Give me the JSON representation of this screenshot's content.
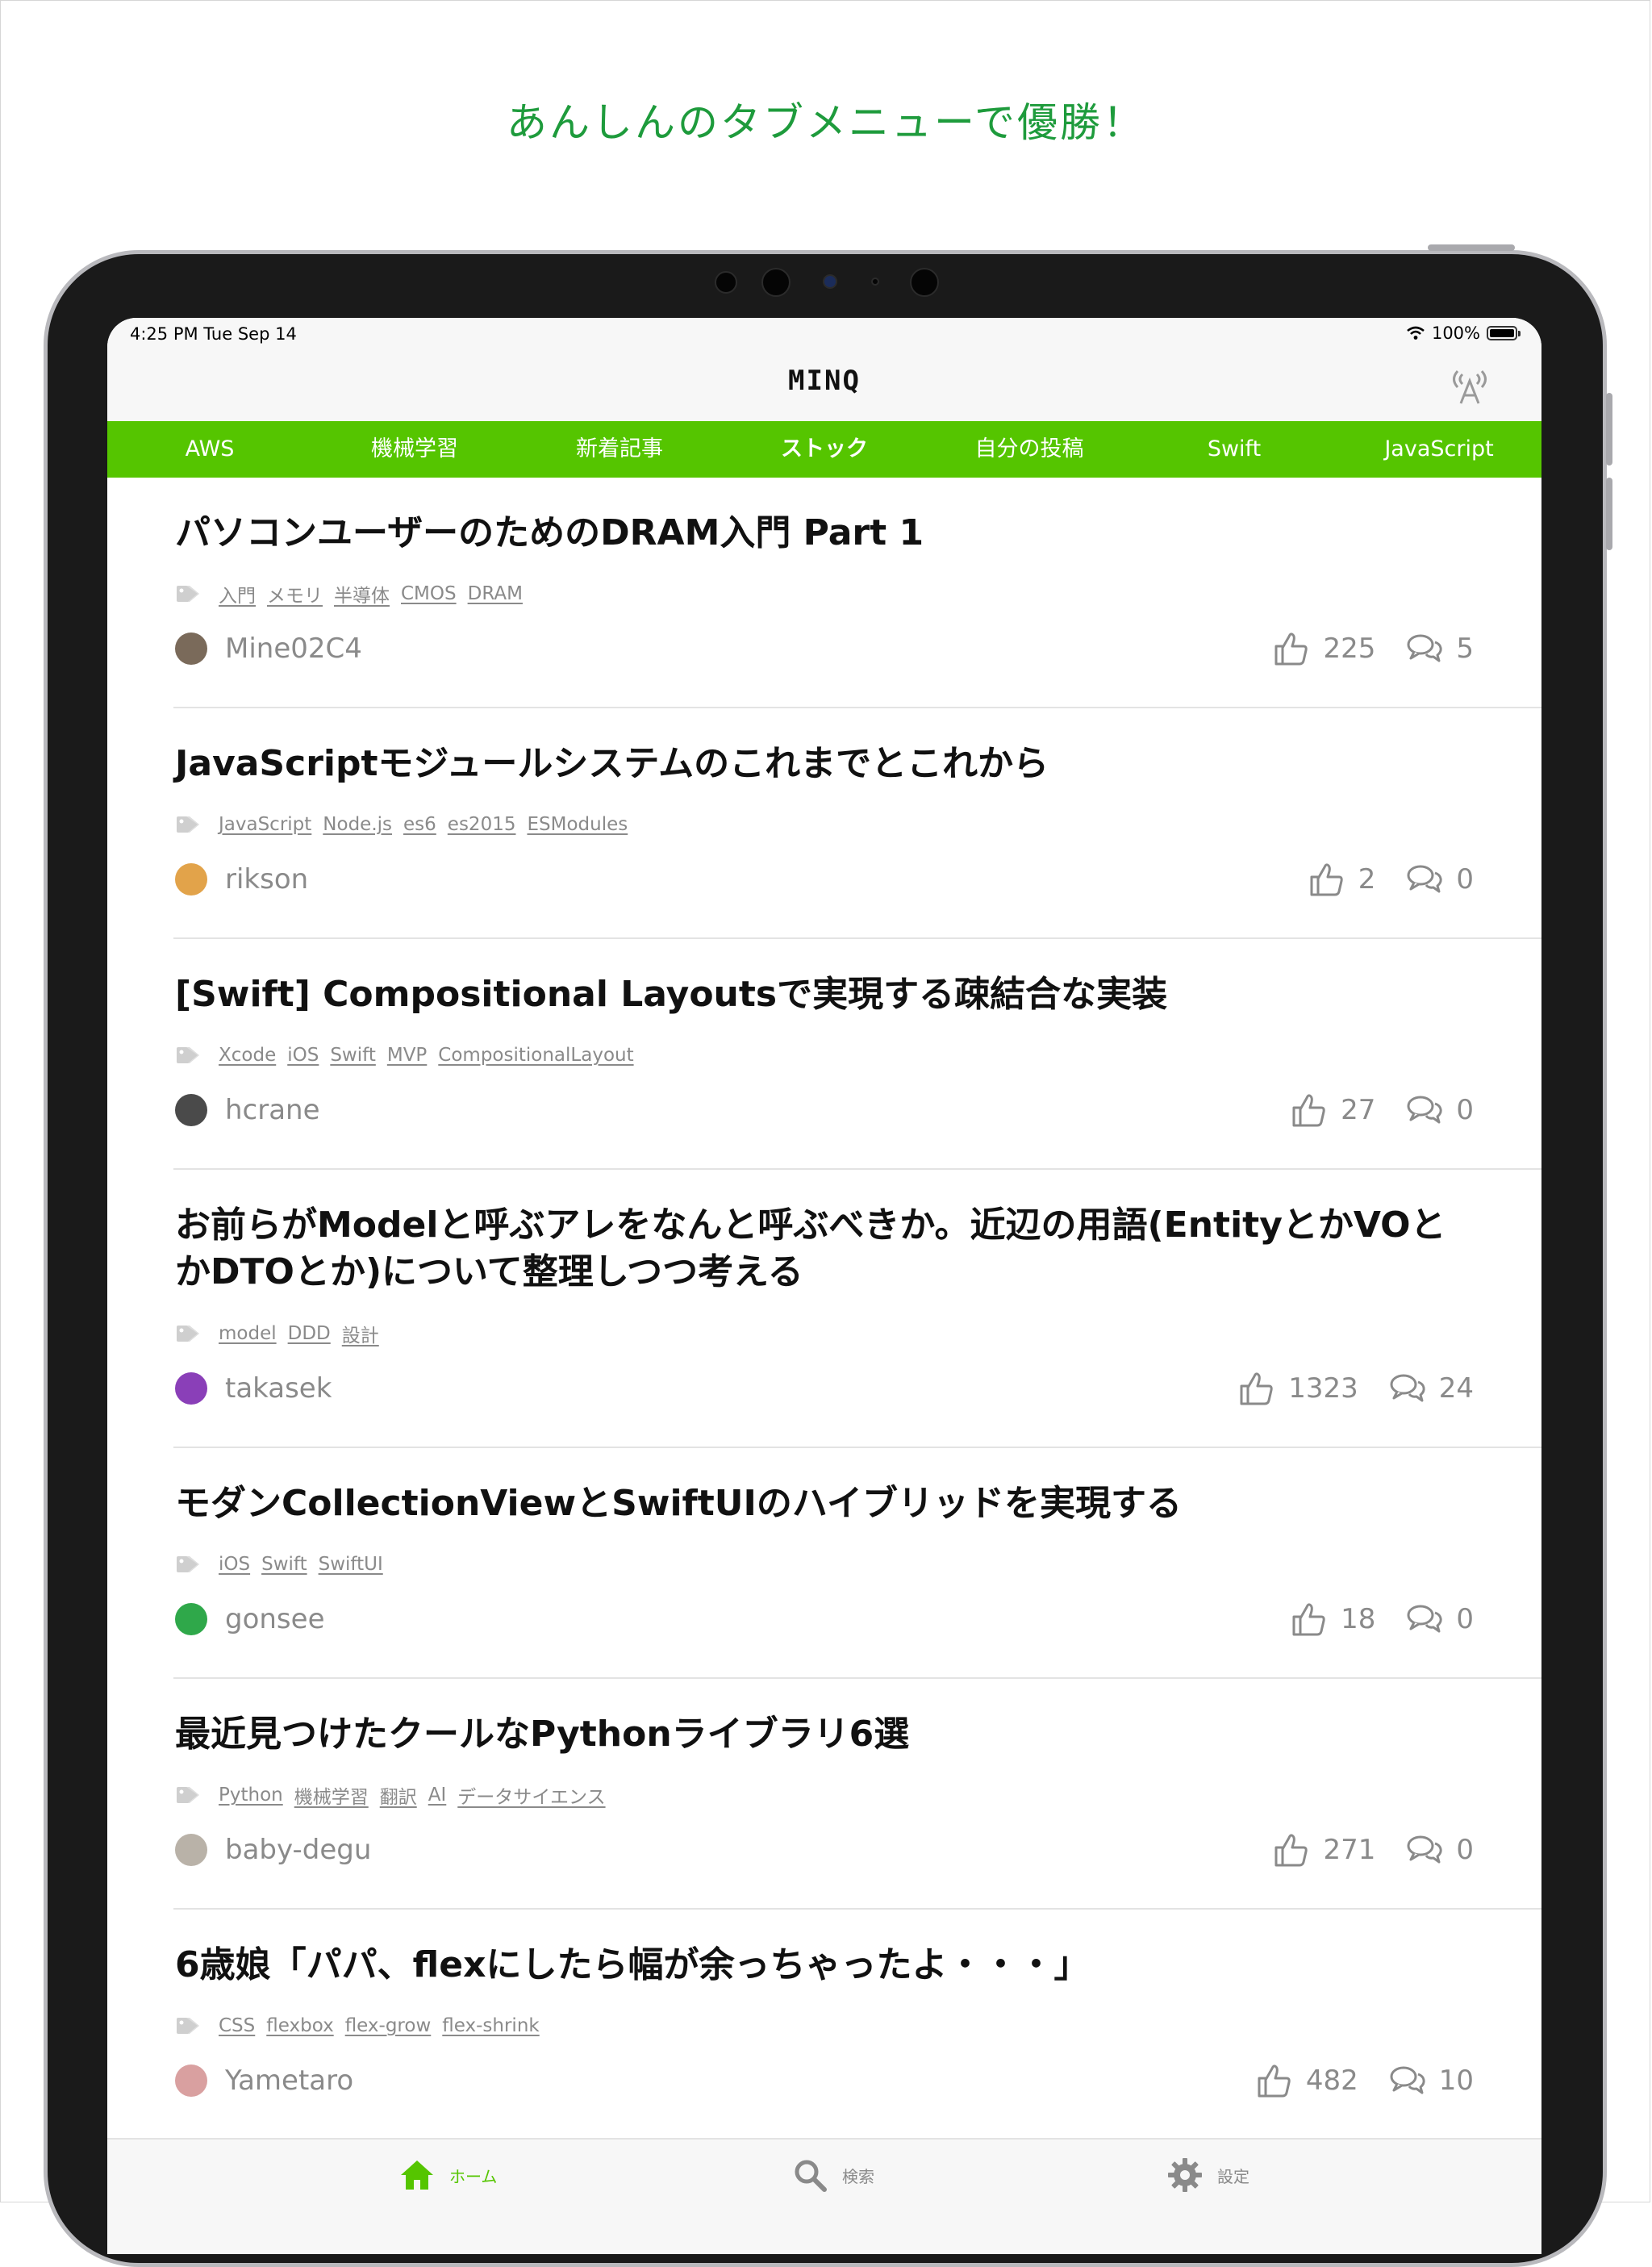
{
  "headline": "あんしんのタブメニューで優勝！",
  "status_bar": {
    "time": "4:25 PM   Tue Sep 14",
    "battery": "100%"
  },
  "nav": {
    "logo": "MINQ",
    "broadcast_icon": "broadcast-icon"
  },
  "tabs": [
    {
      "label": "AWS",
      "active": false
    },
    {
      "label": "機械学習",
      "active": false
    },
    {
      "label": "新着記事",
      "active": false
    },
    {
      "label": "ストック",
      "active": true
    },
    {
      "label": "自分の投稿",
      "active": false
    },
    {
      "label": "Swift",
      "active": false
    },
    {
      "label": "JavaScript",
      "active": false
    }
  ],
  "articles": [
    {
      "title": "パソコンユーザーのためのDRAM入門 Part 1",
      "tags": [
        "入門",
        "メモリ",
        "半導体",
        "CMOS",
        "DRAM"
      ],
      "author": "Mine02C4",
      "likes": "225",
      "comments": "5",
      "avatar_color": "#7a6a5a"
    },
    {
      "title": "JavaScriptモジュールシステムのこれまでとこれから",
      "tags": [
        "JavaScript",
        "Node.js",
        "es6",
        "es2015",
        "ESModules"
      ],
      "author": "rikson",
      "likes": "2",
      "comments": "0",
      "avatar_color": "#e2a34a"
    },
    {
      "title": "[Swift] Compositional Layoutsで実現する疎結合な実装",
      "tags": [
        "Xcode",
        "iOS",
        "Swift",
        "MVP",
        "CompositionalLayout"
      ],
      "author": "hcrane",
      "likes": "27",
      "comments": "0",
      "avatar_color": "#4a4a4a"
    },
    {
      "title": "お前らがModelと呼ぶアレをなんと呼ぶべきか。近辺の用語(EntityとかVOとかDTOとか)について整理しつつ考える",
      "tags": [
        "model",
        "DDD",
        "設計"
      ],
      "author": "takasek",
      "likes": "1323",
      "comments": "24",
      "avatar_color": "#8a3fb8"
    },
    {
      "title": "モダンCollectionViewとSwiftUIのハイブリッドを実現する",
      "tags": [
        "iOS",
        "Swift",
        "SwiftUI"
      ],
      "author": "gonsee",
      "likes": "18",
      "comments": "0",
      "avatar_color": "#2fa84a"
    },
    {
      "title": "最近見つけたクールなPythonライブラリ6選",
      "tags": [
        "Python",
        "機械学習",
        "翻訳",
        "AI",
        "データサイエンス"
      ],
      "author": "baby-degu",
      "likes": "271",
      "comments": "0",
      "avatar_color": "#b9b2a8"
    },
    {
      "title": "6歳娘「パパ、flexにしたら幅が余っちゃったよ・・・」",
      "tags": [
        "CSS",
        "flexbox",
        "flex-grow",
        "flex-shrink"
      ],
      "author": "Yametaro",
      "likes": "482",
      "comments": "10",
      "avatar_color": "#d9a0a0"
    }
  ],
  "bottom_tabs": [
    {
      "label": "ホーム",
      "icon": "home-icon",
      "active": true
    },
    {
      "label": "検索",
      "icon": "search-icon",
      "active": false
    },
    {
      "label": "設定",
      "icon": "gear-icon",
      "active": false
    }
  ],
  "colors": {
    "accent": "#55c500",
    "headline": "#1e9b3c",
    "muted": "#8a8a8a"
  }
}
